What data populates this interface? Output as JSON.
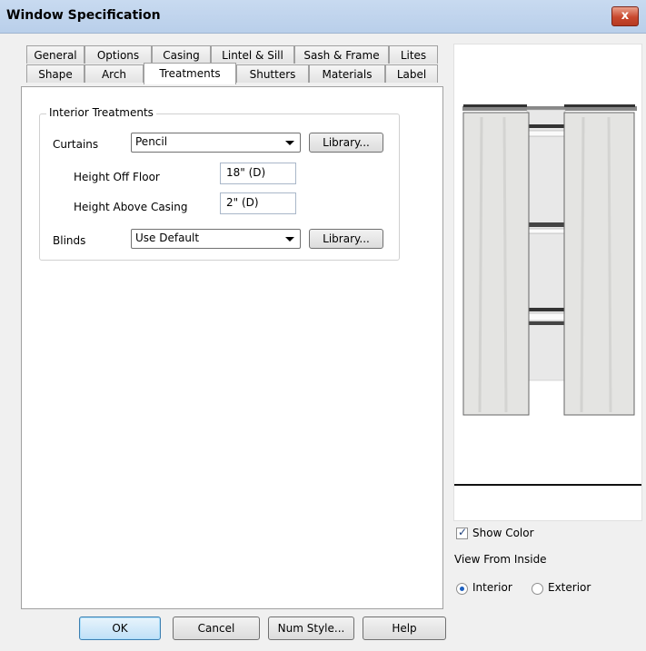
{
  "window": {
    "title": "Window Specification",
    "close_label": "x"
  },
  "tabs_row1": [
    "General",
    "Options",
    "Casing",
    "Lintel & Sill",
    "Sash & Frame",
    "Lites"
  ],
  "tabs_row2": [
    "Shape",
    "Arch",
    "Treatments",
    "Shutters",
    "Materials",
    "Label"
  ],
  "active_tab": "Treatments",
  "interior_treatments": {
    "group_label": "Interior Treatments",
    "curtains_label": "Curtains",
    "curtains_value": "Pencil",
    "library_label": "Library...",
    "height_off_floor_label": "Height Off Floor",
    "height_off_floor_value": "18\" (D)",
    "height_above_casing_label": "Height Above Casing",
    "height_above_casing_value": "2\" (D)",
    "blinds_label": "Blinds",
    "blinds_value": "Use Default",
    "blinds_library_label": "Library..."
  },
  "preview_options": {
    "show_color_label": "Show Color",
    "show_color_checked": true,
    "view_from_inside_label": "View From Inside",
    "interior_label": "Interior",
    "exterior_label": "Exterior",
    "selected": "Interior"
  },
  "buttons": {
    "ok": "OK",
    "cancel": "Cancel",
    "num_style": "Num Style...",
    "help": "Help"
  }
}
